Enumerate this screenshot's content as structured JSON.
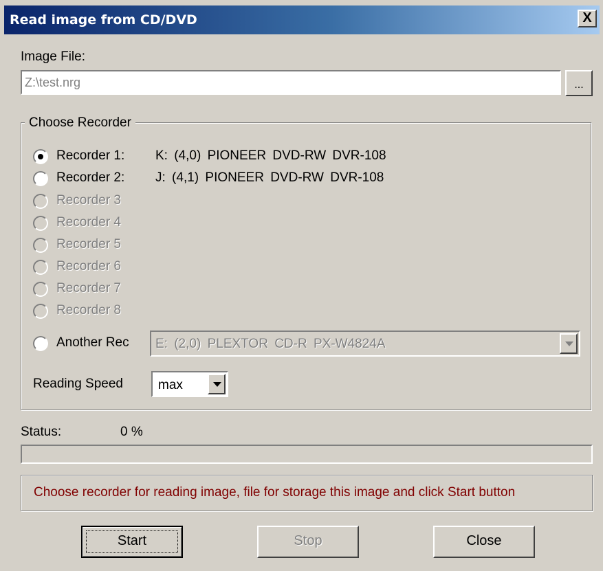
{
  "window": {
    "title": "Read image from CD/DVD",
    "close_glyph": "X"
  },
  "image_file": {
    "label": "Image File:",
    "value": "Z:\\test.nrg",
    "browse_label": "..."
  },
  "recorder_group": {
    "legend": "Choose Recorder",
    "recorders": [
      {
        "label": "Recorder 1:",
        "drive": "K:  (4,0)  PIONEER  DVD-RW  DVR-108",
        "selected": true,
        "enabled": true
      },
      {
        "label": "Recorder 2:",
        "drive": "J:  (4,1)  PIONEER  DVD-RW  DVR-108",
        "selected": false,
        "enabled": true
      },
      {
        "label": "Recorder 3",
        "enabled": false
      },
      {
        "label": "Recorder 4",
        "enabled": false
      },
      {
        "label": "Recorder 5",
        "enabled": false
      },
      {
        "label": "Recorder 6",
        "enabled": false
      },
      {
        "label": "Recorder 7",
        "enabled": false
      },
      {
        "label": "Recorder 8",
        "enabled": false
      }
    ],
    "another": {
      "label": "Another Rec",
      "value": "E:  (2,0)  PLEXTOR  CD-R   PX-W4824A"
    },
    "speed": {
      "label": "Reading Speed",
      "value": "max"
    }
  },
  "status": {
    "label": "Status:",
    "percent_text": "0 %",
    "progress": 0
  },
  "message": "Choose recorder for reading image, file for storage this image and click Start button",
  "buttons": {
    "start": "Start",
    "stop": "Stop",
    "close": "Close"
  },
  "colors": {
    "face": "#d4d0c8",
    "title_start": "#0a246a",
    "title_end": "#a6caf0",
    "message_text": "#800000",
    "disabled_text": "#808080"
  }
}
